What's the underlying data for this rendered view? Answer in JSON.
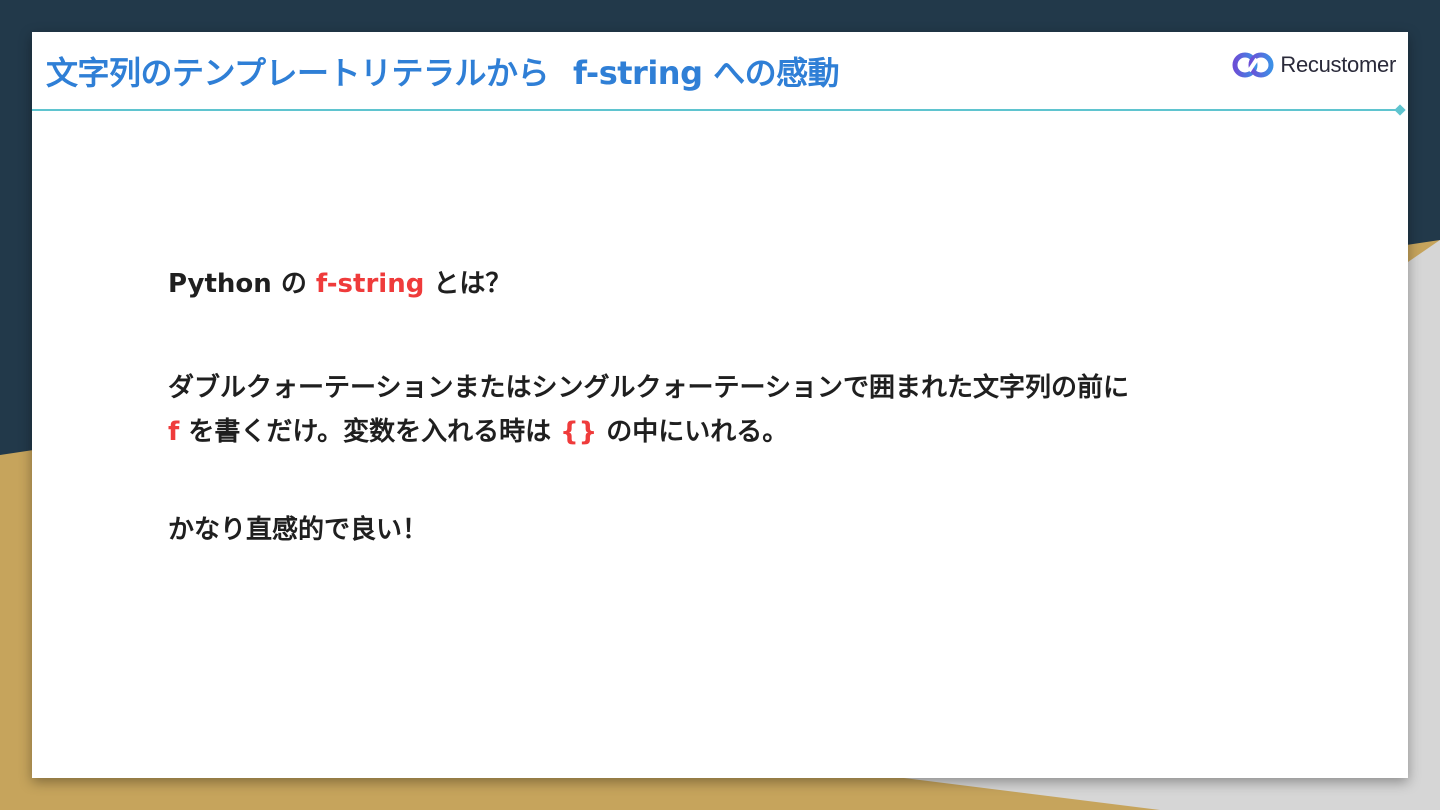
{
  "colors": {
    "title": "#2f7fd6",
    "accent_red": "#ef3b3b",
    "rule": "#5fc4cf",
    "bg_dark": "#22394a",
    "bg_gold": "#c6a45c",
    "bg_gray": "#d6d6d6"
  },
  "slide": {
    "title_ja": "文字列のテンプレートリテラルから",
    "title_en": "f-string への感動",
    "logo_text": "Recustomer",
    "logo_icon": "link-infinity-icon"
  },
  "content": {
    "line1": {
      "prefix": "Python の ",
      "highlight": "f-string",
      "suffix": " とは？"
    },
    "line2": {
      "text_a": "ダブルクォーテーションまたはシングルクォーテーションで囲まれた文字列の前に",
      "f": "f",
      "text_b": " を書くだけ。変数を入れる時は ",
      "braces": "{}",
      "text_c": " の中にいれる。"
    },
    "line3": "かなり直感的で良い！"
  }
}
